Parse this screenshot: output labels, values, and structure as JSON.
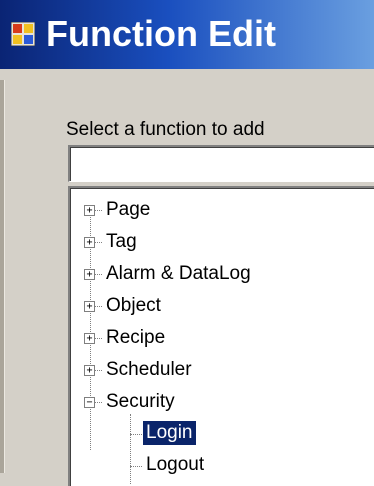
{
  "window": {
    "title": "Function Edit",
    "icon": "app-window-icon"
  },
  "form": {
    "prompt": "Select a function to add",
    "input_value": ""
  },
  "tree": {
    "nodes": [
      {
        "label": "Page",
        "expanded": false
      },
      {
        "label": "Tag",
        "expanded": false
      },
      {
        "label": "Alarm & DataLog",
        "expanded": false
      },
      {
        "label": "Object",
        "expanded": false
      },
      {
        "label": "Recipe",
        "expanded": false
      },
      {
        "label": "Scheduler",
        "expanded": false
      },
      {
        "label": "Security",
        "expanded": true
      }
    ],
    "security_children": [
      {
        "label": "Login",
        "selected": true
      },
      {
        "label": "Logout",
        "selected": false
      }
    ]
  },
  "colors": {
    "titlebar_start": "#0a2474",
    "titlebar_end": "#6a9fe0",
    "selection": "#0a246a",
    "dialog_bg": "#d4d0c8"
  }
}
